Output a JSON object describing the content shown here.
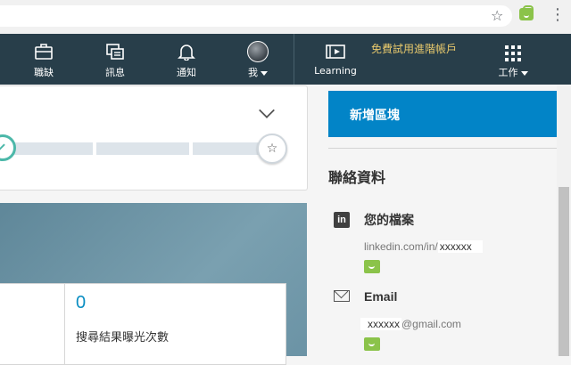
{
  "browser": {
    "star_icon": "star-outline",
    "extension_icon": "shopping-bag",
    "menu_icon": "kebab"
  },
  "nav": {
    "items": [
      {
        "label": "職缺",
        "icon": "briefcase-icon"
      },
      {
        "label": "訊息",
        "icon": "messages-icon"
      },
      {
        "label": "通知",
        "icon": "bell-icon"
      },
      {
        "label": "我",
        "icon": "avatar"
      },
      {
        "label": "Learning",
        "icon": "learning-icon"
      },
      {
        "label": "工作",
        "icon": "grid-icon"
      }
    ],
    "premium_label": "免費試用進階帳戶",
    "colors": {
      "background": "#283e4a",
      "premium": "#e7c86c"
    }
  },
  "profile_strength": {
    "progress_completed_steps": 1,
    "progress_total_steps": 4
  },
  "stats": {
    "search_appearances": "0",
    "search_appearances_label": "搜尋結果曝光次數"
  },
  "sidebar": {
    "add_section_label": "新增區塊",
    "contact_title": "聯絡資料",
    "profile_label": "您的檔案",
    "profile_url_prefix": "linkedin.com/in/",
    "profile_url_handle": "xxxxxx",
    "email_label": "Email",
    "email_user": "xxxxxx",
    "email_domain": "@gmail.com",
    "colors": {
      "add_section_bg": "#0284c7"
    }
  }
}
